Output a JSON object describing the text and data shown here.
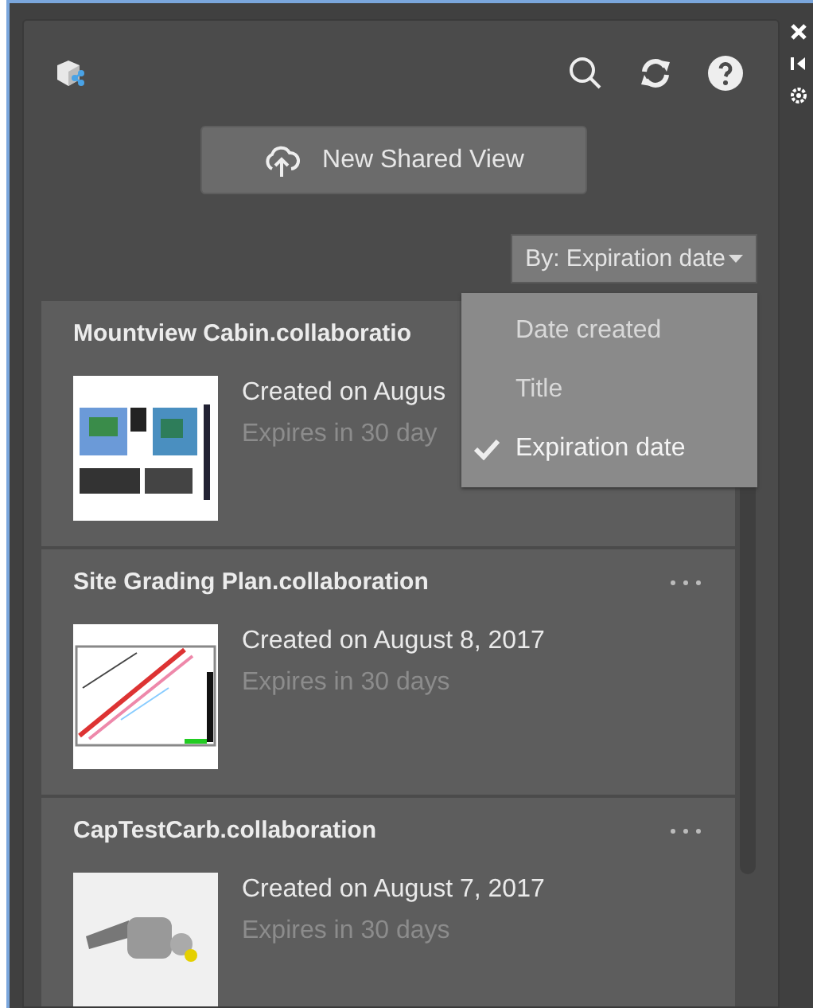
{
  "toolbar": {
    "new_button": "New Shared View"
  },
  "sort": {
    "label": "By: Expiration date",
    "menu": [
      {
        "label": "Date created",
        "selected": false
      },
      {
        "label": "Title",
        "selected": false
      },
      {
        "label": "Expiration date",
        "selected": true
      }
    ]
  },
  "views": [
    {
      "title": "Mountview Cabin.collaboratio",
      "created": "Created on Augus",
      "expires": "Expires in 30 day",
      "kind": "plan",
      "menu_visible": false
    },
    {
      "title": "Site Grading Plan.collaboration",
      "created": "Created on August 8, 2017",
      "expires": "Expires in 30 days",
      "kind": "site",
      "menu_visible": true
    },
    {
      "title": "CapTestCarb.collaboration",
      "created": "Created on August 7, 2017",
      "expires": "Expires in 30 days",
      "kind": "part",
      "menu_visible": true
    }
  ]
}
